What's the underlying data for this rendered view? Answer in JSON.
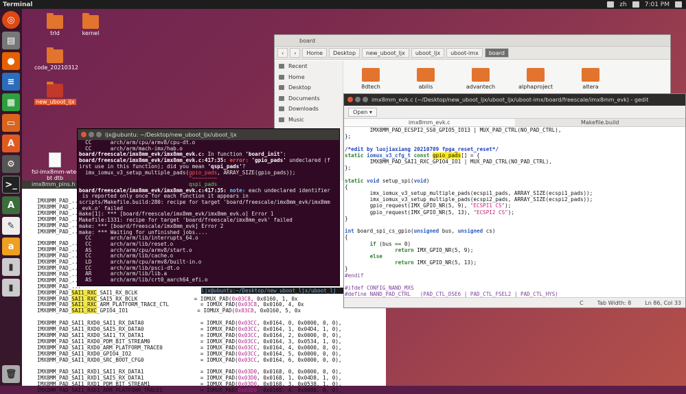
{
  "topbar": {
    "app": "Terminal",
    "time": "7:01 PM",
    "lang": "zh"
  },
  "desktop": [
    {
      "label": "trld"
    },
    {
      "label": "kernel"
    },
    {
      "label": "code_20210312"
    },
    {
      "label": "new_uboot_ljx"
    },
    {
      "label": "fsl-imx8mm-wte-bt dtb"
    }
  ],
  "filemanager": {
    "title": "board",
    "crumbs": [
      "Home",
      "Desktop",
      "new_uboot_ljx",
      "uboot_ljx",
      "uboot-imx",
      "board"
    ],
    "sidebar": [
      "Recent",
      "Home",
      "Desktop",
      "Documents",
      "Downloads",
      "Music"
    ],
    "folders": [
      "8dtech",
      "abilis",
      "advantech",
      "alphaproject",
      "altera"
    ]
  },
  "gedit": {
    "title": "imx8mm_evk.c (~/Desktop/new_uboot_ljx/uboot_ljx/uboot-imx/board/freescale/imx8mm_evk) - gedit",
    "open": "Open",
    "tabs": [
      "imx8mm_evk.c",
      "Makefile.build"
    ],
    "status": {
      "lang": "C",
      "tab": "Tab Width: 8",
      "pos": "Ln 86, Col 33"
    }
  },
  "terminal": {
    "title": "ljx@ubuntu: ~/Desktop/new_uboot_ljx/uboot_ljx",
    "prompt2": "ljx@ubuntu:~/Desktop/new_uboot_ljx/uboot_lj"
  },
  "backeditor": {
    "title": "imx8mm_pins.h"
  }
}
